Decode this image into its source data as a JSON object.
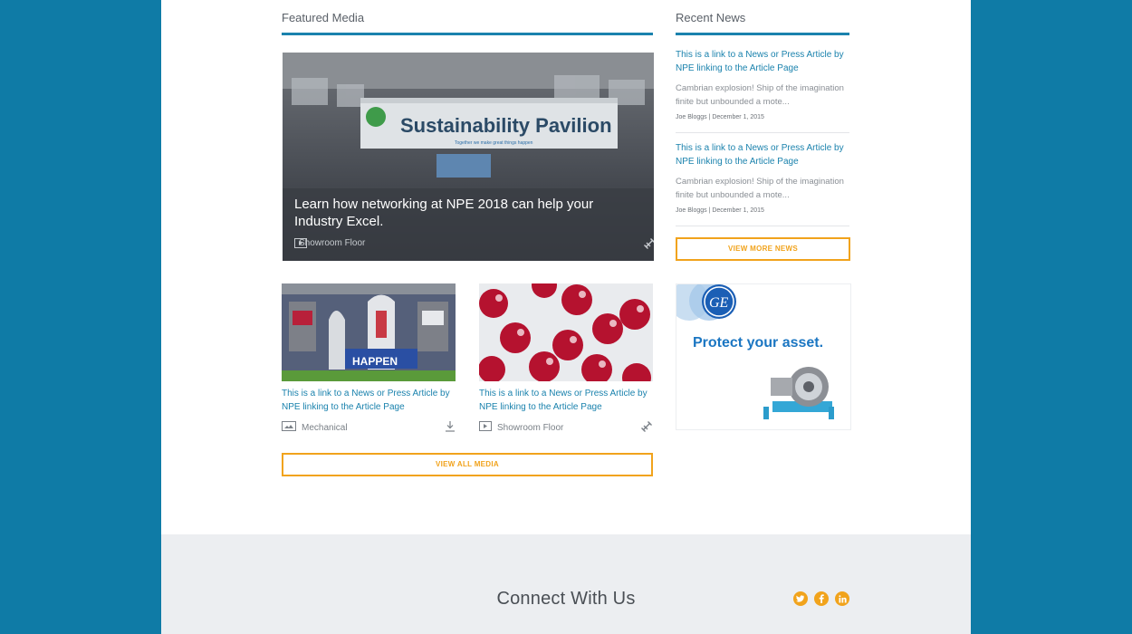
{
  "featured": {
    "title": "Featured Media",
    "hero": {
      "caption": "Learn how networking at NPE 2018 can help your Industry Excel.",
      "category": "Showroom Floor",
      "banner_text": "Sustainability Pavilion",
      "banner_tagline": "Together we make great things happen"
    },
    "cards": [
      {
        "link": "This is a link to a News or Press Article by NPE linking to the Article Page",
        "category": "Mechanical",
        "action_icon": "download-icon",
        "thumb_text": "HAPPEN"
      },
      {
        "link": "This is a link to a News or Press Article by NPE linking to the Article Page",
        "category": "Showroom Floor",
        "action_icon": "link-icon"
      }
    ],
    "view_all": "VIEW ALL MEDIA"
  },
  "news": {
    "title": "Recent News",
    "items": [
      {
        "link": "This is a link to a News or Press Article by NPE linking to the Article Page",
        "excerpt": "Cambrian explosion! Ship of the imagination finite but unbounded a mote...",
        "meta": "Joe Bloggs | December 1, 2015"
      },
      {
        "link": "This is a link to a News or Press Article by NPE linking to the Article Page",
        "excerpt": "Cambrian explosion! Ship of the imagination finite but unbounded a mote...",
        "meta": "Joe Bloggs | December 1, 2015"
      }
    ],
    "view_more": "VIEW MORE NEWS"
  },
  "ad": {
    "headline": "Protect your asset.",
    "logo_text": "GE"
  },
  "footer": {
    "title": "Connect With Us",
    "social": [
      "twitter-icon",
      "facebook-icon",
      "linkedin-icon"
    ]
  },
  "colors": {
    "background": "#0f7ba6",
    "accent": "#1a82ad",
    "button": "#f1a31c"
  }
}
